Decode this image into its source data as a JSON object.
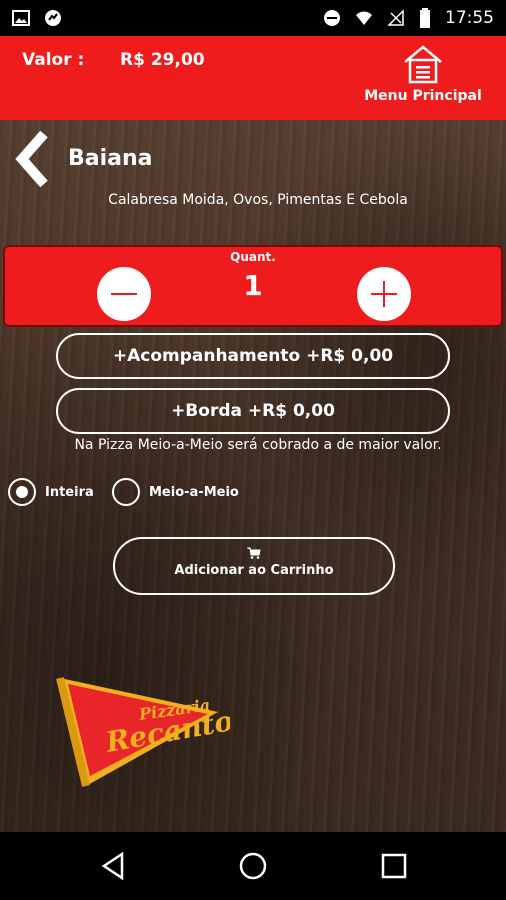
{
  "status_bar": {
    "time": "17:55",
    "icons": [
      "image-icon",
      "sync-icon",
      "do-not-disturb-icon",
      "wifi-icon",
      "no-signal-icon",
      "battery-icon"
    ]
  },
  "header": {
    "valor_label": "Valor :",
    "valor_value": "R$ 29,00",
    "menu_label": "Menu Principal",
    "background_color": "#ee1c1c"
  },
  "product": {
    "name": "Baiana",
    "description": "Calabresa Moida, Ovos, Pimentas E Cebola"
  },
  "quantity": {
    "label": "Quant.",
    "value": "1"
  },
  "options": {
    "acompanhamento_label": "+Acompanhamento +R$ 0,00",
    "borda_label": "+Borda +R$ 0,00",
    "note": "Na Pizza Meio-a-Meio será cobrado a de maior valor."
  },
  "size_choice": {
    "options": [
      {
        "label": "Inteira",
        "selected": true
      },
      {
        "label": "Meio-a-Meio",
        "selected": false
      }
    ]
  },
  "cart": {
    "label": "Adicionar ao Carrinho"
  },
  "logo": {
    "line1": "Pizzaria",
    "line2": "Recanto"
  },
  "navigation": {
    "buttons": [
      "back-icon",
      "home-icon",
      "recents-icon"
    ]
  }
}
